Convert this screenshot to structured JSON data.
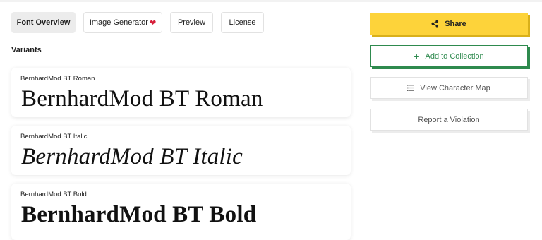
{
  "tabs": [
    {
      "label": "Font Overview"
    },
    {
      "label": "Image Generator"
    },
    {
      "label": "Preview"
    },
    {
      "label": "License"
    }
  ],
  "heart_icon": "heart-icon",
  "variants_heading": "Variants",
  "variants": [
    {
      "label": "BernhardMod BT Roman",
      "sample": "BernhardMod BT Roman",
      "style": "roman"
    },
    {
      "label": "BernhardMod BT Italic",
      "sample": "BernhardMod BT Italic",
      "style": "italic"
    },
    {
      "label": "BernhardMod BT Bold",
      "sample": "BernhardMod BT Bold",
      "style": "bold"
    }
  ],
  "actions": {
    "share": {
      "label": "Share",
      "icon": "share-icon"
    },
    "add_to_collection": {
      "label": "Add to Collection",
      "icon": "plus-icon"
    },
    "view_character_map": {
      "label": "View Character Map",
      "icon": "list-icon"
    },
    "report": {
      "label": "Report a Violation"
    }
  },
  "colors": {
    "accent_yellow": "#fdd33a",
    "accent_green": "#2e8a4e",
    "heart_red": "#d61f3a"
  }
}
